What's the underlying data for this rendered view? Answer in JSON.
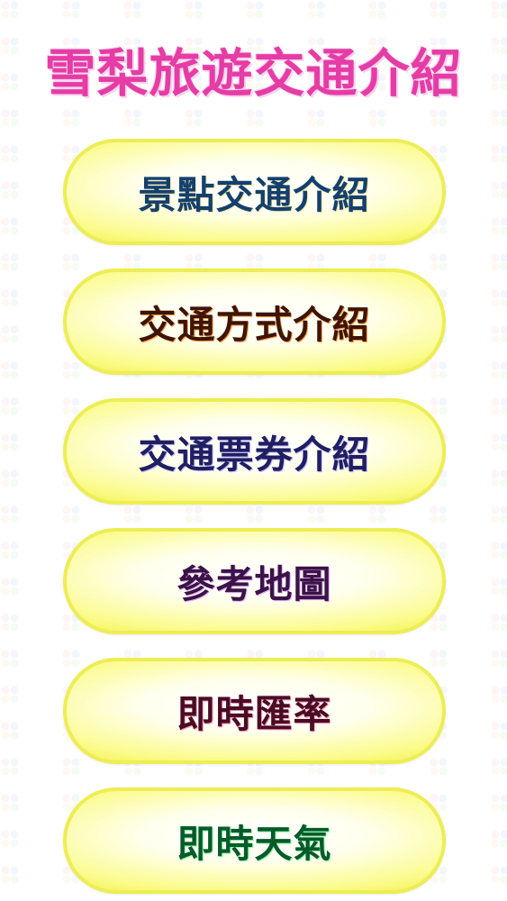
{
  "title": "雪梨旅遊交通介紹",
  "menu": {
    "items": [
      {
        "label": "景點交通介紹",
        "color": "#13406e"
      },
      {
        "label": "交通方式介紹",
        "color": "#3d1405"
      },
      {
        "label": "交通票券介紹",
        "color": "#1f1f61"
      },
      {
        "label": "參考地圖",
        "color": "#3a1446"
      },
      {
        "label": "即時匯率",
        "color": "#4a0c24"
      },
      {
        "label": "即時天氣",
        "color": "#075a2c"
      }
    ]
  },
  "colors": {
    "title": "#e63ca6",
    "button_fill": "#fbfb8a",
    "button_border": "#eded55"
  }
}
